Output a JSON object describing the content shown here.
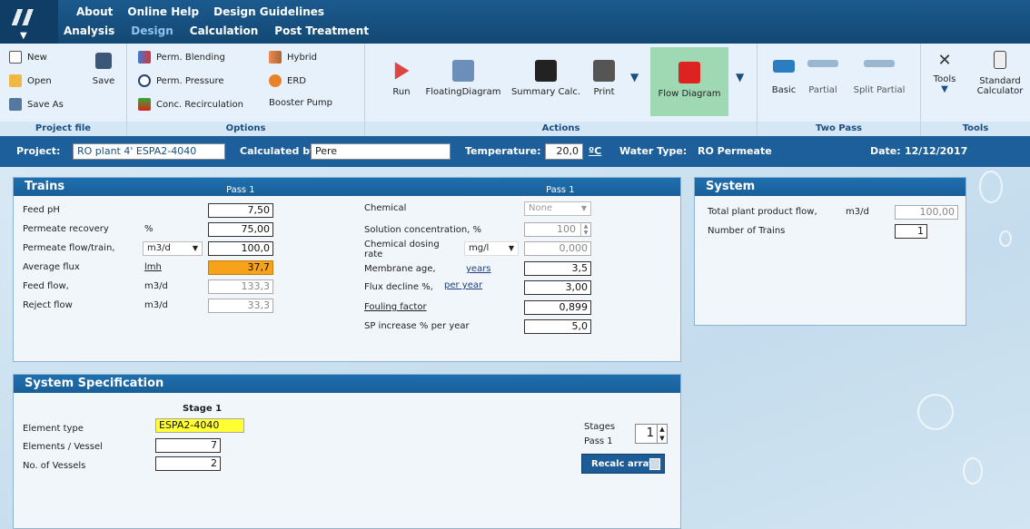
{
  "menu": {
    "top": [
      "About",
      "Online Help",
      "Design Guidelines"
    ],
    "bottom": [
      "Analysis",
      "Design",
      "Calculation",
      "Post Treatment"
    ],
    "active": "Design"
  },
  "ribbon": {
    "project_file": {
      "label": "Project file",
      "new": "New",
      "open": "Open",
      "save": "Save",
      "save_as": "Save As"
    },
    "options": {
      "label": "Options",
      "perm_blending": "Perm. Blending",
      "hybrid": "Hybrid",
      "perm_pressure": "Perm. Pressure",
      "erd": "ERD",
      "conc_recirculation": "Conc. Recirculation",
      "booster_pump": "Booster Pump"
    },
    "actions": {
      "label": "Actions",
      "run": "Run",
      "floating_diagram": "FloatingDiagram",
      "summary_calc": "Summary Calc.",
      "print": "Print",
      "flow_diagram": "Flow Diagram"
    },
    "two_pass": {
      "label": "Two Pass",
      "basic": "Basic",
      "partial": "Partial",
      "split_partial": "Split Partial"
    },
    "tools": {
      "label": "Tools",
      "tools": "Tools",
      "standard_calculator": "Standard Calculator"
    }
  },
  "project_bar": {
    "project_label": "Project:",
    "project_value": "RO plant 4' ESPA2-4040",
    "calculated_by_label": "Calculated by:",
    "calculated_by_value": "Pere",
    "temperature_label": "Temperature:",
    "temperature_value": "20,0",
    "temperature_unit": "ºC",
    "water_type_label": "Water Type:",
    "water_type_value": "RO Permeate",
    "date_label": "Date:",
    "date_value": "12/12/2017"
  },
  "trains": {
    "title": "Trains",
    "pass_label": "Pass 1",
    "pass_label_right": "Pass 1",
    "feed_ph": {
      "label": "Feed pH",
      "value": "7,50"
    },
    "permeate_recovery": {
      "label": "Permeate recovery",
      "unit": "%",
      "value": "75,00"
    },
    "permeate_flow": {
      "label": "Permeate flow/train,",
      "unit": "m3/d",
      "value": "100,0"
    },
    "average_flux": {
      "label": "Average flux",
      "unit": "lmh",
      "value": "37,7"
    },
    "feed_flow": {
      "label": "Feed flow,",
      "unit": "m3/d",
      "value": "133,3"
    },
    "reject_flow": {
      "label": "Reject flow",
      "unit": "m3/d",
      "value": "33,3"
    },
    "chemical": {
      "label": "Chemical",
      "value": "None"
    },
    "solution_concentration": {
      "label": "Solution concentration, %",
      "value": "100"
    },
    "chemical_dosing": {
      "label": "Chemical dosing rate",
      "unit": "mg/l",
      "value": "0,000"
    },
    "membrane_age": {
      "label": "Membrane age,",
      "unit": "years",
      "value": "3,5"
    },
    "flux_decline": {
      "label": "Flux decline %,",
      "unit": "per year",
      "value": "3,00"
    },
    "fouling_factor": {
      "label": "Fouling factor",
      "value": "0,899"
    },
    "sp_increase": {
      "label": "SP increase % per year",
      "value": "5,0"
    }
  },
  "system": {
    "title": "System",
    "total_plant_flow": {
      "label": "Total plant product flow,",
      "unit": "m3/d",
      "value": "100,00"
    },
    "number_of_trains": {
      "label": "Number of Trains",
      "value": "1"
    }
  },
  "system_spec": {
    "title": "System Specification",
    "stage_label": "Stage 1",
    "element_type": {
      "label": "Element type",
      "value": "ESPA2-4040"
    },
    "elements_per_vessel": {
      "label": "Elements / Vessel",
      "value": "7"
    },
    "no_of_vessels": {
      "label": "No. of Vessels",
      "value": "2"
    },
    "stages_label": "Stages",
    "pass_label": "Pass 1",
    "stages_value": "1",
    "recalc_button": "Recalc array"
  },
  "colors": {
    "header_blue": "#1d5f9b",
    "highlight_orange": "#f7a21b",
    "element_yellow": "#ffff33",
    "flow_diagram_green": "#9fd9b4"
  }
}
